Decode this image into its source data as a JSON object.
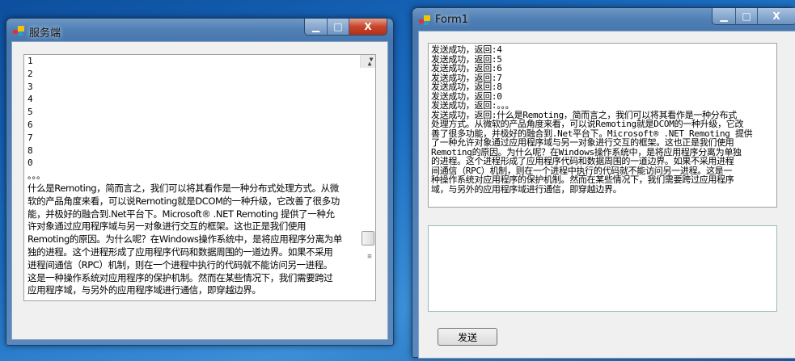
{
  "server_window": {
    "title": "服务端",
    "list_items": [
      "1",
      "2",
      "3",
      "4",
      "5",
      "6",
      "7",
      "8",
      "0",
      "。。。"
    ],
    "wrapped_lines": [
      "什么是Remoting，简而言之，我们可以将其看作是一种分布式处理方式。从微",
      "软的产品角度来看，可以说Remoting就是DCOM的一种升级，它改善了很多功",
      "能，并极好的融合到.Net平台下。Microsoft® .NET Remoting 提供了一种允",
      "许对象通过应用程序域与另一对象进行交互的框架。这也正是我们使用",
      "Remoting的原因。为什么呢？在Windows操作系统中，是将应用程序分离为单",
      "独的进程。这个进程形成了应用程序代码和数据周围的一道边界。如果不采用",
      "进程间通信（RPC）机制，则在一个进程中执行的代码就不能访问另一进程。",
      "这是一种操作系统对应用程序的保护机制。然而在某些情况下，我们需要跨过",
      "应用程序域，与另外的应用程序域进行通信，即穿越边界。"
    ]
  },
  "client_window": {
    "title": "Form1",
    "log_lines": [
      "发送成功，返回:4",
      "发送成功，返回:5",
      "发送成功，返回:6",
      "发送成功，返回:7",
      "发送成功，返回:8",
      "发送成功，返回:0",
      "发送成功，返回:。。。",
      "发送成功，返回:什么是Remoting，简而言之，我们可以将其看作是一种分布式",
      "处理方式。从微软的产品角度来看，可以说Remoting就是DCOM的一种升级，它改",
      "善了很多功能，并极好的融合到.Net平台下。Microsoft® .NET Remoting 提供",
      "了一种允许对象通过应用程序域与另一对象进行交互的框架。这也正是我们使用",
      "Remoting的原因。为什么呢？在Windows操作系统中，是将应用程序分离为单独",
      "的进程。这个进程形成了应用程序代码和数据周围的一道边界。如果不采用进程",
      "间通信（RPC）机制，则在一个进程中执行的代码就不能访问另一进程。这是一",
      "种操作系统对应用程序的保护机制。然而在某些情况下，我们需要跨过应用程序",
      "域，与另外的应用程序域进行通信，即穿越边界。"
    ],
    "input_value": "",
    "send_label": "发送"
  },
  "caption_buttons": {
    "minimize": "▁",
    "maximize": "□",
    "close": "X"
  }
}
